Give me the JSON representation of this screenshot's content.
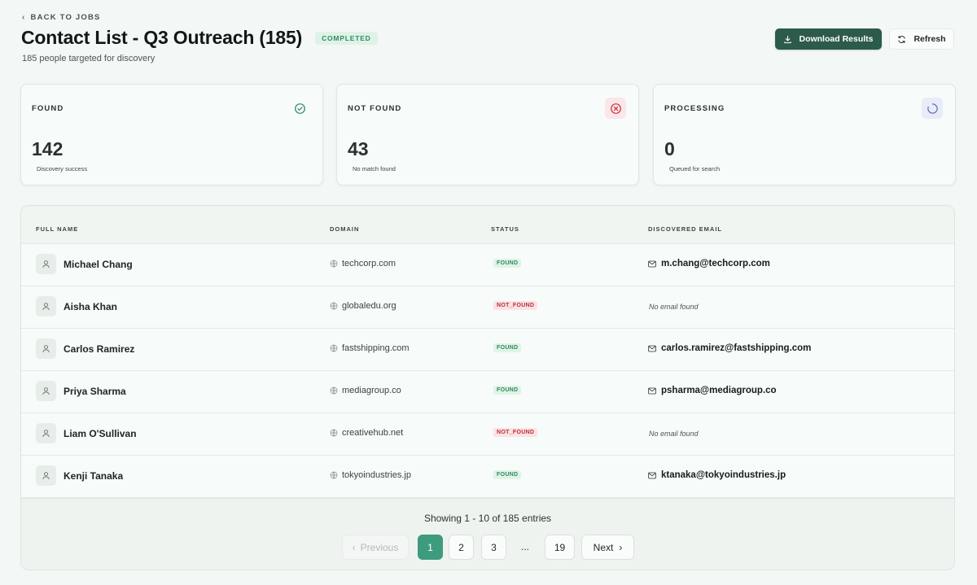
{
  "header": {
    "back_label": "BACK TO JOBS",
    "title": "Contact List - Q3 Outreach (185)",
    "status_badge": "COMPLETED",
    "subtitle": "185 people targeted for discovery",
    "download_label": "Download Results",
    "refresh_label": "Refresh"
  },
  "stats": [
    {
      "label": "FOUND",
      "value": "142",
      "caption": "Discovery success",
      "icon": "check-circle-icon",
      "color": "#2f8a64"
    },
    {
      "label": "NOT FOUND",
      "value": "43",
      "caption": "No match found",
      "icon": "x-circle-icon",
      "color": "#c8323d"
    },
    {
      "label": "PROCESSING",
      "value": "0",
      "caption": "Queued for search",
      "icon": "spinner-icon",
      "color": "#5b6bbf"
    }
  ],
  "table": {
    "columns": [
      "FULL NAME",
      "DOMAIN",
      "STATUS",
      "DISCOVERED EMAIL"
    ],
    "rows": [
      {
        "name": "Michael Chang",
        "domain": "techcorp.com",
        "status": "FOUND",
        "email": "m.chang@techcorp.com"
      },
      {
        "name": "Aisha Khan",
        "domain": "globaledu.org",
        "status": "NOT_FOUND",
        "email": "No email found"
      },
      {
        "name": "Carlos Ramirez",
        "domain": "fastshipping.com",
        "status": "FOUND",
        "email": "carlos.ramirez@fastshipping.com"
      },
      {
        "name": "Priya Sharma",
        "domain": "mediagroup.co",
        "status": "FOUND",
        "email": "psharma@mediagroup.co"
      },
      {
        "name": "Liam O'Sullivan",
        "domain": "creativehub.net",
        "status": "NOT_FOUND",
        "email": "No email found"
      },
      {
        "name": "Kenji Tanaka",
        "domain": "tokyoindustries.jp",
        "status": "FOUND",
        "email": "ktanaka@tokyoindustries.jp"
      }
    ]
  },
  "pagination": {
    "showing": "Showing 1 - 10 of 185 entries",
    "previous": "Previous",
    "pages": [
      "1",
      "2",
      "3"
    ],
    "ellipsis": "...",
    "last_page": "19",
    "next": "Next",
    "current_page": "1"
  }
}
